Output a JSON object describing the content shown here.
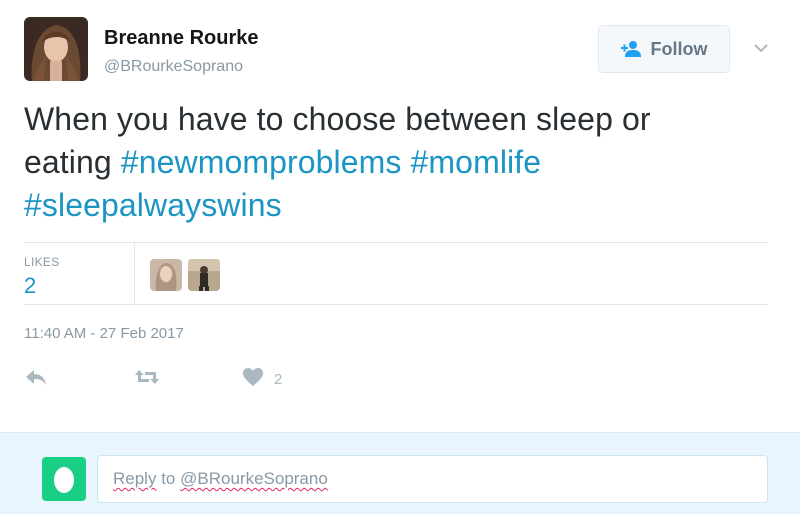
{
  "user": {
    "name": "Breanne Rourke",
    "handle": "@BRourkeSoprano"
  },
  "follow_button": {
    "label": "Follow"
  },
  "tweet": {
    "line1": "When you have to choose between sleep or",
    "line2_word": "eating",
    "hashtags": [
      "#newmomproblems",
      "#momlife",
      "#sleepalwayswins"
    ]
  },
  "stats": {
    "likes_label": "LIKES",
    "likes_value": "2"
  },
  "timestamp": "11:40 AM - 27 Feb 2017",
  "actions": {
    "like_count": "2"
  },
  "reply": {
    "placeholder_word": "Reply",
    "placeholder_to": "to",
    "placeholder_handle": "@BRourkeSoprano"
  },
  "colors": {
    "link": "#1b95c4",
    "muted": "#8899a6",
    "reply_bg": "#e8f5fd",
    "reply_avatar": "#19cf86"
  },
  "icons": {
    "follow": "add-user-icon",
    "caret": "chevron-down-icon",
    "reply": "reply-icon",
    "retweet": "retweet-icon",
    "like": "heart-icon",
    "egg": "egg-avatar-icon"
  }
}
